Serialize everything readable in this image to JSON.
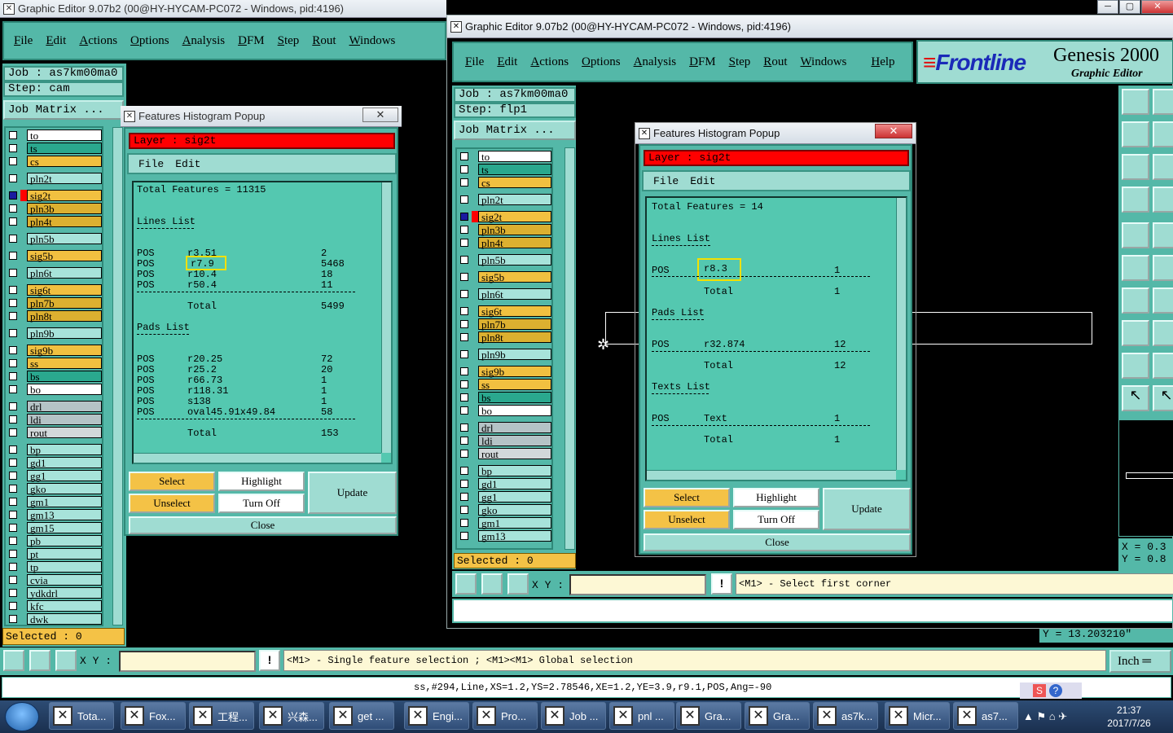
{
  "win1": {
    "title": "Graphic Editor 9.07b2 (00@HY-HYCAM-PC072 - Windows, pid:4196)",
    "menu": [
      "File",
      "Edit",
      "Actions",
      "Options",
      "Analysis",
      "DFM",
      "Step",
      "Rout",
      "Windows"
    ],
    "job": "Job : as7km00ma0",
    "step": "Step: cam",
    "job_matrix": "Job Matrix ...",
    "selected": "Selected : 0"
  },
  "win2": {
    "title": "Graphic Editor 9.07b2 (00@HY-HYCAM-PC072 - Windows, pid:4196)",
    "menu": [
      "File",
      "Edit",
      "Actions",
      "Options",
      "Analysis",
      "DFM",
      "Step",
      "Rout",
      "Windows"
    ],
    "help": "Help",
    "job": "Job : as7km00ma0",
    "step": "Step: flp1",
    "job_matrix": "Job Matrix ...",
    "selected": "Selected : 0",
    "brand": "Frontline",
    "product": "Genesis 2000",
    "product_sub": "Graphic Editor",
    "xy_label": "X Y :",
    "status_msg": "<M1> - Select first corner",
    "coord_x": "X = 0.3",
    "coord_y": "Y = 0.8",
    "ycoord": "Y = 13.203210\"",
    "unit": "Inch"
  },
  "layers1": [
    "to",
    "ts",
    "cs",
    "pln2t",
    "sig2t",
    "pln3b",
    "pln4t",
    "pln5b",
    "sig5b",
    "pln6t",
    "sig6t",
    "pln7b",
    "pln8t",
    "pln9b",
    "sig9b",
    "ss",
    "bs",
    "bo",
    "drl",
    "ldi",
    "rout",
    "bp",
    "gd1",
    "gg1",
    "gko",
    "gm1",
    "gm13",
    "gm15",
    "pb",
    "pt",
    "tp",
    "cvia",
    "ydkdrl",
    "kfc",
    "dwk"
  ],
  "layers2": [
    "to",
    "ts",
    "cs",
    "pln2t",
    "sig2t",
    "pln3b",
    "pln4t",
    "pln5b",
    "sig5b",
    "pln6t",
    "sig6t",
    "pln7b",
    "pln8t",
    "pln9b",
    "sig9b",
    "ss",
    "bs",
    "bo",
    "drl",
    "ldi",
    "rout",
    "bp",
    "gd1",
    "gg1",
    "gko",
    "gm1",
    "gm13"
  ],
  "popup1": {
    "title": "Features Histogram Popup",
    "layer": "Layer :  sig2t",
    "menu": [
      "File",
      "Edit"
    ],
    "total": "Total Features = 11315",
    "lines_title": "Lines List",
    "lines": [
      [
        "POS",
        "r3.51",
        "2"
      ],
      [
        "POS",
        "r7.9",
        "5468"
      ],
      [
        "POS",
        "r10.4",
        "18"
      ],
      [
        "POS",
        "r50.4",
        "11"
      ]
    ],
    "lines_total": [
      "Total",
      "5499"
    ],
    "pads_title": "Pads List",
    "pads": [
      [
        "POS",
        "r20.25",
        "72"
      ],
      [
        "POS",
        "r25.2",
        "20"
      ],
      [
        "POS",
        "r66.73",
        "1"
      ],
      [
        "POS",
        "r118.31",
        "1"
      ],
      [
        "POS",
        "s138",
        "1"
      ],
      [
        "POS",
        "oval45.91x49.84",
        "58"
      ]
    ],
    "pads_total": [
      "Total",
      "153"
    ],
    "buttons": {
      "select": "Select",
      "highlight": "Highlight",
      "update": "Update",
      "unselect": "Unselect",
      "turnoff": "Turn Off",
      "close": "Close"
    }
  },
  "popup2": {
    "title": "Features Histogram Popup",
    "layer": "Layer :  sig2t",
    "menu": [
      "File",
      "Edit"
    ],
    "total": "Total Features = 14",
    "lines_title": "Lines List",
    "lines": [
      [
        "POS",
        "r8.3",
        "1"
      ]
    ],
    "lines_total": [
      "Total",
      "1"
    ],
    "pads_title": "Pads List",
    "pads": [
      [
        "POS",
        "r32.874",
        "12"
      ]
    ],
    "pads_total": [
      "Total",
      "12"
    ],
    "texts_title": "Texts List",
    "texts": [
      [
        "POS",
        "Text",
        "1"
      ]
    ],
    "texts_total": [
      "Total",
      "1"
    ],
    "buttons": {
      "select": "Select",
      "highlight": "Highlight",
      "update": "Update",
      "unselect": "Unselect",
      "turnoff": "Turn Off",
      "close": "Close"
    }
  },
  "bottom": {
    "xy_label": "X Y :",
    "status_msg": "<M1> - Single feature selection ; <M1><M1> Global selection",
    "feature_info": "ss,#294,Line,XS=1.2,YS=2.78546,XE=1.2,YE=3.9,r9.1,POS,Ang=-90"
  },
  "taskbar": {
    "items": [
      "Tota...",
      "Fox...",
      "工程...",
      "兴森...",
      "get ...",
      "Engi...",
      "Pro...",
      "Job ...",
      "pnl ...",
      "Gra...",
      "Gra...",
      "as7k...",
      "Micr...",
      "as7..."
    ],
    "time": "21:37",
    "date": "2017/7/26"
  },
  "colors": {
    "teal": "#54b8a8",
    "highlight_box": "#f4e000",
    "layerbar": "#ff0000"
  }
}
